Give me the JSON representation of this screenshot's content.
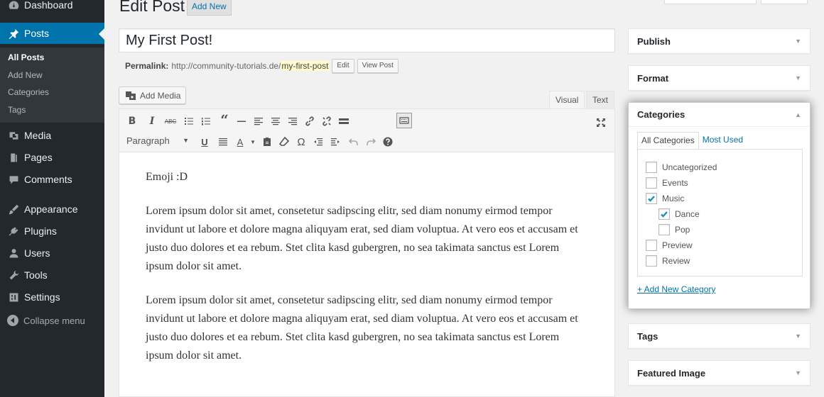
{
  "sidebar": {
    "items": [
      {
        "label": "Dashboard",
        "icon": "dashboard-icon"
      },
      {
        "label": "Posts",
        "icon": "pin-icon"
      },
      {
        "label": "Media",
        "icon": "media-icon"
      },
      {
        "label": "Pages",
        "icon": "pages-icon"
      },
      {
        "label": "Comments",
        "icon": "comments-icon"
      },
      {
        "label": "Appearance",
        "icon": "appearance-icon"
      },
      {
        "label": "Plugins",
        "icon": "plugins-icon"
      },
      {
        "label": "Users",
        "icon": "users-icon"
      },
      {
        "label": "Tools",
        "icon": "tools-icon"
      },
      {
        "label": "Settings",
        "icon": "settings-icon"
      }
    ],
    "submenu": [
      "All Posts",
      "Add New",
      "Categories",
      "Tags"
    ],
    "collapse_label": "Collapse menu"
  },
  "header": {
    "title": "Edit Post",
    "add_new_label": "Add New"
  },
  "post": {
    "title": "My First Post!",
    "permalink_label": "Permalink:",
    "permalink_base": "http://community-tutorials.de/",
    "permalink_slug": "my-first-post",
    "edit_label": "Edit",
    "view_label": "View Post"
  },
  "editor": {
    "add_media_label": "Add Media",
    "tab_visual": "Visual",
    "tab_text": "Text",
    "format_select": "Paragraph",
    "paragraphs": [
      "Emoji :D",
      "Lorem ipsum dolor sit amet, consetetur sadipscing elitr, sed diam nonumy eirmod tempor invidunt ut labore et dolore magna aliquyam erat, sed diam voluptua. At vero eos et accusam et justo duo dolores et ea rebum. Stet clita kasd gubergren, no sea takimata sanctus est Lorem ipsum dolor sit amet.",
      "Lorem ipsum dolor sit amet, consetetur sadipscing elitr, sed diam nonumy eirmod tempor invidunt ut labore et dolore magna aliquyam erat, sed diam voluptua. At vero eos et accusam et justo duo dolores et ea rebum. Stet clita kasd gubergren, no sea takimata sanctus est Lorem ipsum dolor sit amet."
    ]
  },
  "metaboxes": {
    "publish": "Publish",
    "format": "Format",
    "categories": {
      "title": "Categories",
      "tab_all": "All Categories",
      "tab_used": "Most Used",
      "items": [
        {
          "label": "Uncategorized",
          "checked": false
        },
        {
          "label": "Events",
          "checked": false
        },
        {
          "label": "Music",
          "checked": true
        },
        {
          "label": "Dance",
          "checked": true
        },
        {
          "label": "Pop",
          "checked": false
        },
        {
          "label": "Preview",
          "checked": false
        },
        {
          "label": "Review",
          "checked": false
        }
      ],
      "add_new_label": "+ Add New Category"
    },
    "tags": "Tags",
    "featured_image": "Featured Image"
  },
  "colors": {
    "sidebar_bg": "#23282d",
    "accent": "#0073aa",
    "page_bg": "#f1f1f1"
  }
}
